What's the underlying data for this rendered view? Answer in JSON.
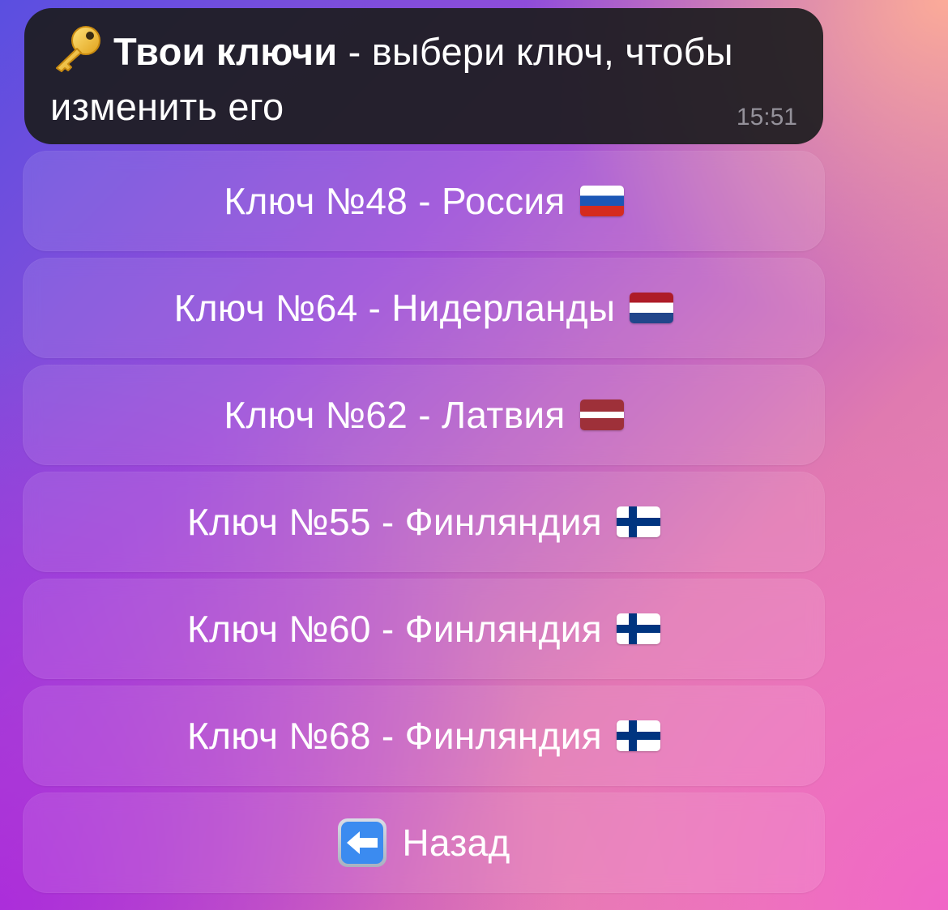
{
  "message": {
    "icon": "key-icon",
    "title_bold": "Твои ключи",
    "text": " - выбери ключ, чтобы изменить его",
    "time": "15:51"
  },
  "keyboard": {
    "buttons": [
      {
        "label": "Ключ №48 - Россия",
        "flag": "flag-russia-icon"
      },
      {
        "label": "Ключ №64 - Нидерланды",
        "flag": "flag-netherlands-icon"
      },
      {
        "label": "Ключ №62 - Латвия",
        "flag": "flag-latvia-icon"
      },
      {
        "label": "Ключ №55 - Финляндия",
        "flag": "flag-finland-icon"
      },
      {
        "label": "Ключ №60 - Финляндия",
        "flag": "flag-finland-icon"
      },
      {
        "label": "Ключ №68 - Финляндия",
        "flag": "flag-finland-icon"
      }
    ],
    "back": {
      "label": "Назад",
      "icon": "back-arrow-icon"
    }
  },
  "colors": {
    "bubble_bg": "#1c1c1e",
    "text": "#ffffff",
    "russia": [
      "#ffffff",
      "#1c57b6",
      "#d52b1e"
    ],
    "netherlands": [
      "#ae1c28",
      "#ffffff",
      "#21468b"
    ],
    "latvia": [
      "#9e3039",
      "#ffffff"
    ],
    "finland": [
      "#ffffff",
      "#003580"
    ]
  }
}
